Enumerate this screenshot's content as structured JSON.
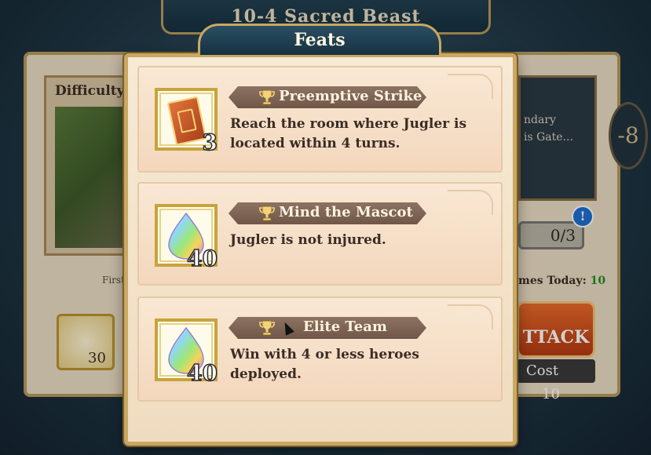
{
  "background": {
    "stage_title": "10-4  Sacred Beast",
    "difficulty_label": "Difficulty",
    "first_clear_label": "First",
    "reward_count": "30",
    "right_text_line1": "ndary",
    "right_text_line2": "is Gate...",
    "progress": "0/3",
    "info_icon": "!",
    "times_label": "mes Today:",
    "times_value": "10",
    "attack_label": "TTACK",
    "cost_label": "Cost",
    "cost_value": "10",
    "side_glyph": "-8"
  },
  "modal": {
    "title": "Feats",
    "feats": [
      {
        "title": "Preemptive Strike",
        "description": "Reach the room where Jugler is located within 4 turns.",
        "reward_icon": "card-icon",
        "reward_count": "3"
      },
      {
        "title": "Mind the Mascot",
        "description": "Jugler is not injured.",
        "reward_icon": "orb-icon",
        "reward_count": "40"
      },
      {
        "title": "Elite Team",
        "description": "Win with 4 or less heroes deployed.",
        "reward_icon": "orb-icon",
        "reward_count": "40"
      }
    ]
  },
  "colors": {
    "modal_bg": "#f6ead5",
    "frame_gold": "#c9a862",
    "banner_brown": "#7d6355",
    "header_blue": "#1f4052",
    "attack_orange": "#d0531c",
    "times_green": "#1f8f1f"
  }
}
